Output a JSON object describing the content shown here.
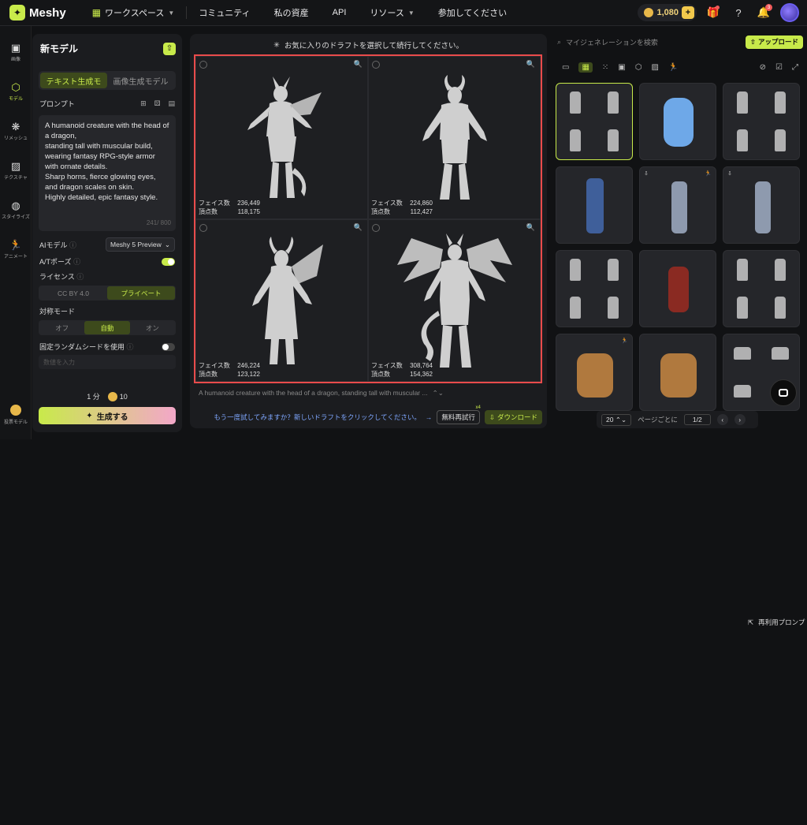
{
  "app": {
    "logo": "Meshy"
  },
  "nav": {
    "workspace": "ワークスペース",
    "community": "コミュニティ",
    "assets": "私の資産",
    "api": "API",
    "resources": "リソース",
    "join": "参加してください"
  },
  "credits": {
    "value": "1,080",
    "plus": "+"
  },
  "notifications": {
    "count": "3"
  },
  "rail": {
    "items": [
      {
        "label": "画像",
        "icon": "image-icon"
      },
      {
        "label": "モデル",
        "icon": "cube-icon"
      },
      {
        "label": "リメッシュ",
        "icon": "remesh-icon"
      },
      {
        "label": "テクスチャ",
        "icon": "texture-icon"
      },
      {
        "label": "スタイライズ",
        "icon": "stylize-icon"
      },
      {
        "label": "アニメート",
        "icon": "run-icon"
      }
    ],
    "bottom_label": "投票モデル"
  },
  "left_panel": {
    "title": "新モデル",
    "tabs": [
      "テキスト生成モ",
      "画像生成モデル"
    ],
    "prompt_label": "プロンプト",
    "prompt_text": "A humanoid creature with the head of a dragon,\nstanding tall with muscular build,\nwearing fantasy RPG-style armor with ornate details.\nSharp horns, fierce glowing eyes, and dragon scales on skin.\nHighly detailed, epic fantasy style.",
    "prompt_count": "241/ 800",
    "ai_model_label": "AIモデル",
    "ai_model_value": "Meshy 5 Preview",
    "at_pose_label": "A/Tポーズ",
    "license_label": "ライセンス",
    "license_options": [
      "CC BY 4.0",
      "プライベート"
    ],
    "symmetry_label": "対称モード",
    "symmetry_options": [
      "オフ",
      "自動",
      "オン"
    ],
    "seed_label": "固定ランダムシードを使用",
    "seed_placeholder": "数値を入力",
    "time": "1 分",
    "cost": "10",
    "generate_label": "生成する"
  },
  "center": {
    "hint": "お気に入りのドラフトを選択して続行してください。",
    "drafts": [
      {
        "faces_label": "フェイス数",
        "faces": "236,449",
        "verts_label": "頂点数",
        "verts": "118,175"
      },
      {
        "faces_label": "フェイス数",
        "faces": "224,860",
        "verts_label": "頂点数",
        "verts": "112,427"
      },
      {
        "faces_label": "フェイス数",
        "faces": "246,224",
        "verts_label": "頂点数",
        "verts": "123,122"
      },
      {
        "faces_label": "フェイス数",
        "faces": "308,764",
        "verts_label": "頂点数",
        "verts": "154,362"
      }
    ],
    "prompt_preview": "A humanoid creature with the head of a dragon, standing tall with muscular ...",
    "reuse_prompt": "再利用プロンプト",
    "retry_hint": "もう一度試してみますか？新しいドラフトをクリックしてください。",
    "free_retry": "無料再試行",
    "free_retry_count": "x4",
    "download": "ダウンロード"
  },
  "right_panel": {
    "search_placeholder": "マイジェネレーションを検索",
    "upload": "アップロード",
    "pager": {
      "per_page": "20",
      "per_page_label": "ページごとに",
      "page": "1/2"
    }
  },
  "colors": {
    "accent": "#c8ea4a",
    "highlight": "#e94b4b",
    "panel": "#1b1c1f"
  }
}
